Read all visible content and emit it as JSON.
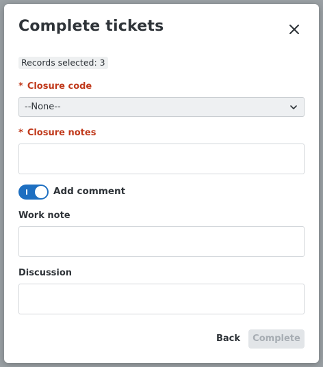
{
  "modal": {
    "title": "Complete tickets",
    "records_selected": "Records selected: 3",
    "closure_code": {
      "required_mark": "*",
      "label": "Closure code",
      "selected_value": "--None--"
    },
    "closure_notes": {
      "required_mark": "*",
      "label": "Closure notes",
      "value": ""
    },
    "add_comment": {
      "label": "Add comment",
      "on": true
    },
    "work_note": {
      "label": "Work note",
      "value": ""
    },
    "discussion": {
      "label": "Discussion",
      "value": ""
    },
    "footer": {
      "back_label": "Back",
      "complete_label": "Complete"
    }
  },
  "icons": {
    "close": "close-icon",
    "dropdown": "chevron-down-icon"
  },
  "colors": {
    "required": "#c0391b",
    "toggle_on": "#1e6fc1",
    "disabled_button_bg": "#e2e5e8",
    "disabled_button_text": "#a7adb3"
  }
}
